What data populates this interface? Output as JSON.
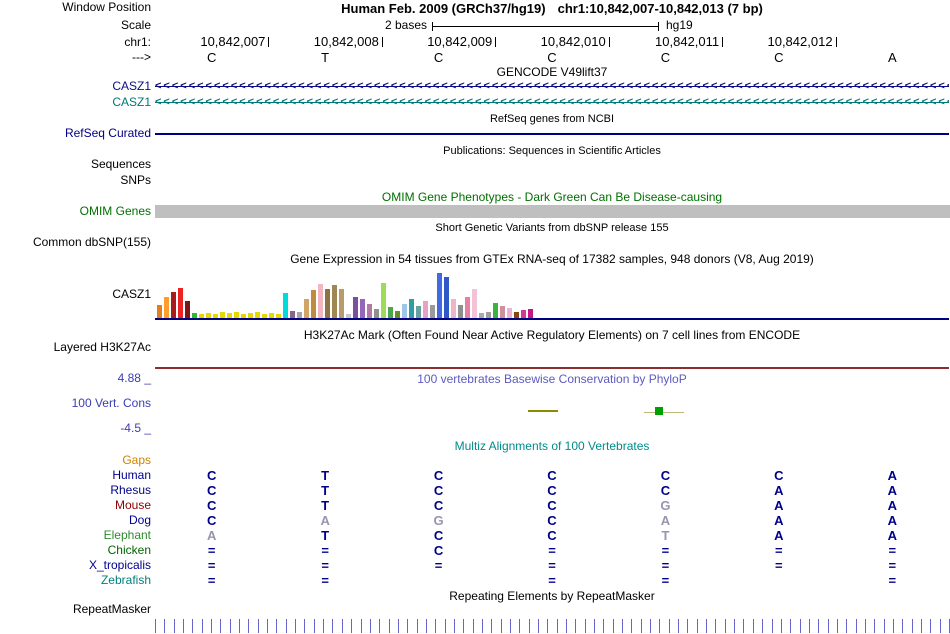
{
  "colors": {
    "gencode_row1": "#0c0c82",
    "gencode_row2": "#007878",
    "refseq_blue": "#000082",
    "omim_green": "#007000",
    "omim_bar_gray": "#bfbfbf",
    "phylop_title_blue": "#5b5bc0",
    "cons_scale_blue": "#3c3cb4",
    "multiz_title_teal": "#008b8b",
    "base_navy": "#00008b",
    "base_dim": "#9595b0",
    "ruler_blue": "#6666cc",
    "baseline_navy": "#000082",
    "h3k27ac_maroon": "#8b2e2e",
    "conservation_olive": "#8b8b00",
    "conservation_green": "#00a000",
    "conservation_pale": "#b8b878"
  },
  "header": {
    "window_position_label": "Window Position",
    "assembly": "Human Feb. 2009 (GRCh37/hg19)",
    "position": "chr1:10,842,007-10,842,013 (7 bp)",
    "scale_label": "Scale",
    "scale_value": "2 bases",
    "genome": "hg19",
    "chrom_label": "chr1:",
    "strand_label": "--->",
    "coordinates": [
      "10,842,007",
      "10,842,008",
      "10,842,009",
      "10,842,010",
      "10,842,011",
      "10,842,012"
    ],
    "reference_bases": [
      "C",
      "T",
      "C",
      "C",
      "C",
      "C",
      "A"
    ]
  },
  "tracks": {
    "gencode": {
      "title": "GENCODE V49lift37",
      "transcripts": [
        {
          "label": "CASZ1",
          "color": "#0c0c82"
        },
        {
          "label": "CASZ1",
          "color": "#007878"
        }
      ]
    },
    "refseq": {
      "title": "RefSeq genes from NCBI",
      "label": "RefSeq Curated"
    },
    "publications": {
      "title": "Publications: Sequences in Scientific Articles",
      "label": "Sequences"
    },
    "snps": {
      "label": "SNPs"
    },
    "omim": {
      "title": "OMIM Gene Phenotypes - Dark Green Can Be Disease-causing",
      "label": "OMIM Genes"
    },
    "dbsnp": {
      "title": "Short Genetic Variants from dbSNP release 155",
      "label": "Common dbSNP(155)"
    },
    "gtex": {
      "title": "Gene Expression in 54 tissues from GTEx RNA-seq of 17382 samples, 948 donors (V8, Aug 2019)",
      "label": "CASZ1"
    },
    "h3k27ac": {
      "title": "H3K27Ac Mark (Often Found Near Active Regulatory Elements) on 7 cell lines from ENCODE",
      "label": "Layered H3K27Ac"
    },
    "conservation": {
      "title": "100 vertebrates Basewise Conservation by PhyloP",
      "label": "100 Vert. Cons",
      "scale_max": "4.88 _",
      "scale_min": "-4.5 _"
    },
    "multiz": {
      "title": "Multiz Alignments of 100 Vertebrates",
      "rows": [
        {
          "label": "Gaps",
          "color": "#cd8500",
          "bases": [
            "",
            "",
            "",
            "",
            "",
            "",
            ""
          ],
          "dim": []
        },
        {
          "label": "Human",
          "color": "#00008b",
          "bases": [
            "C",
            "T",
            "C",
            "C",
            "C",
            "C",
            "A"
          ],
          "dim": []
        },
        {
          "label": "Rhesus",
          "color": "#00008b",
          "bases": [
            "C",
            "T",
            "C",
            "C",
            "C",
            "A",
            "A"
          ],
          "dim": []
        },
        {
          "label": "Mouse",
          "color": "#8b0000",
          "bases": [
            "C",
            "T",
            "C",
            "C",
            "G",
            "A",
            "A"
          ],
          "dim": [
            4
          ]
        },
        {
          "label": "Dog",
          "color": "#00008b",
          "bases": [
            "C",
            "A",
            "G",
            "C",
            "A",
            "A",
            "A"
          ],
          "dim": [
            1,
            2,
            4
          ]
        },
        {
          "label": "Elephant",
          "color": "#2e8b2e",
          "bases": [
            "A",
            "T",
            "C",
            "C",
            "T",
            "A",
            "A"
          ],
          "dim": [
            0,
            4
          ]
        },
        {
          "label": "Chicken",
          "color": "#006400",
          "bases": [
            "=",
            "=",
            "C",
            "=",
            "=",
            "=",
            "="
          ],
          "dim": []
        },
        {
          "label": "X_tropicalis",
          "color": "#00008b",
          "bases": [
            "=",
            "=",
            "=",
            "=",
            "=",
            "=",
            "="
          ],
          "dim": []
        },
        {
          "label": "Zebrafish",
          "color": "#008080",
          "bases": [
            "=",
            "=",
            "",
            "=",
            "=",
            "",
            "="
          ],
          "dim": []
        }
      ]
    },
    "repeatmasker": {
      "title": "Repeating Elements by RepeatMasker",
      "label": "RepeatMasker"
    }
  },
  "chart_data": {
    "type": "bar",
    "title": "Gene Expression in 54 tissues from GTEx RNA-seq of 17382 samples, 948 donors (V8, Aug 2019)",
    "gene": "CASZ1",
    "note": "54 GTEx tissue expression bars; values are relative bar heights read from the plot (no numeric axis shown), colors are GTEx tissue colors",
    "values": [
      13,
      21,
      26,
      30,
      17,
      5,
      4,
      5,
      4,
      6,
      5,
      6,
      4,
      5,
      6,
      4,
      5,
      4,
      25,
      7,
      6,
      19,
      28,
      34,
      29,
      33,
      29,
      4,
      21,
      19,
      14,
      9,
      35,
      11,
      7,
      14,
      19,
      12,
      17,
      13,
      45,
      41,
      19,
      13,
      21,
      29,
      5,
      6,
      15,
      12,
      10,
      6,
      8,
      9
    ],
    "colors": [
      "#e07f1e",
      "#ff9d2e",
      "#aa1c1c",
      "#ee2222",
      "#7d1717",
      "#2eb82e",
      "#e6d700",
      "#e6d700",
      "#e6d700",
      "#e6d700",
      "#e6d700",
      "#e6d700",
      "#e6d700",
      "#e6d700",
      "#e6d700",
      "#e6d700",
      "#e6d700",
      "#e6d700",
      "#00dcdc",
      "#8b668b",
      "#a6a6a6",
      "#d2a567",
      "#c08b3e",
      "#f2b6c0",
      "#8b7342",
      "#a08852",
      "#b89b68",
      "#c8c8c8",
      "#7a4f9e",
      "#9467bd",
      "#b07aa1",
      "#8f8f8f",
      "#9ddb58",
      "#4ca64c",
      "#6b8e23",
      "#9fc5e8",
      "#2e9e9e",
      "#66a0a0",
      "#e8a0c8",
      "#9a9a9a",
      "#4169e1",
      "#2e59c7",
      "#f0b4c8",
      "#8f8f8f",
      "#e87ea1",
      "#f4c2d7",
      "#aaaaaa",
      "#9e9e9e",
      "#3cb43c",
      "#cd919e",
      "#e8b4d2",
      "#8b4513",
      "#d23c8c",
      "#c71585"
    ]
  }
}
